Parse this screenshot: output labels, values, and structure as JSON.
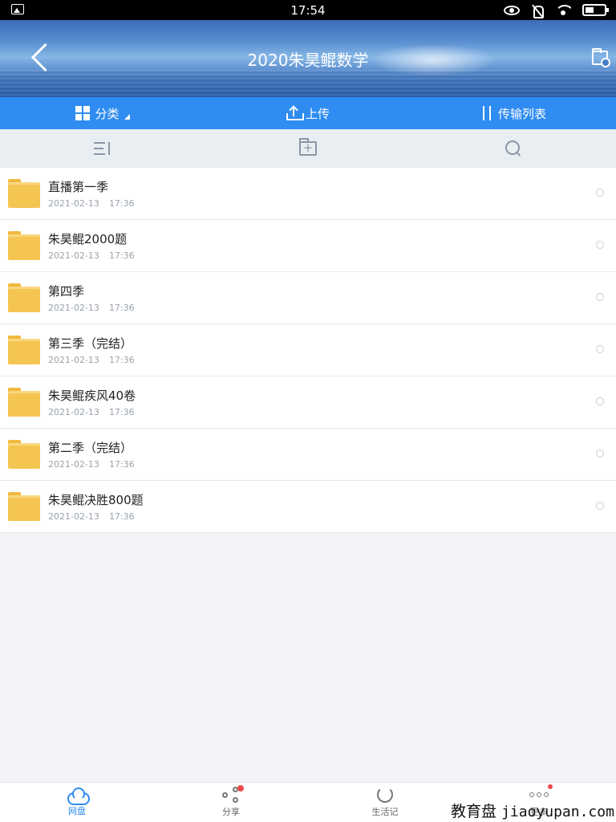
{
  "status_bar": {
    "time": "17:54"
  },
  "header": {
    "title": "2020朱昊鲲数学"
  },
  "toolbar": {
    "category_label": "分类",
    "upload_label": "上传",
    "transfer_label": "传输列表"
  },
  "files": [
    {
      "name": "直播第一季",
      "date": "2021-02-13",
      "time": "17:36"
    },
    {
      "name": "朱昊鲲2000题",
      "date": "2021-02-13",
      "time": "17:36"
    },
    {
      "name": "第四季",
      "date": "2021-02-13",
      "time": "17:36"
    },
    {
      "name": "第三季（完结）",
      "date": "2021-02-13",
      "time": "17:36"
    },
    {
      "name": "朱昊鲲疾风40卷",
      "date": "2021-02-13",
      "time": "17:36"
    },
    {
      "name": "第二季（完结）",
      "date": "2021-02-13",
      "time": "17:36"
    },
    {
      "name": "朱昊鲲决胜800题",
      "date": "2021-02-13",
      "time": "17:36"
    }
  ],
  "bottom_nav": [
    {
      "label": "网盘",
      "icon": "cloud-icon",
      "active": true
    },
    {
      "label": "分享",
      "icon": "share-icon",
      "badge": true
    },
    {
      "label": "生活记",
      "icon": "life-icon"
    },
    {
      "label": "更多",
      "icon": "more-icon",
      "badge": true
    }
  ],
  "watermark": {
    "cn": "教育盘",
    "en": "jiaoyupan.com"
  },
  "colors": {
    "accent": "#2f8cf1",
    "folder": "#f5c552",
    "badge": "#f04a4a"
  }
}
